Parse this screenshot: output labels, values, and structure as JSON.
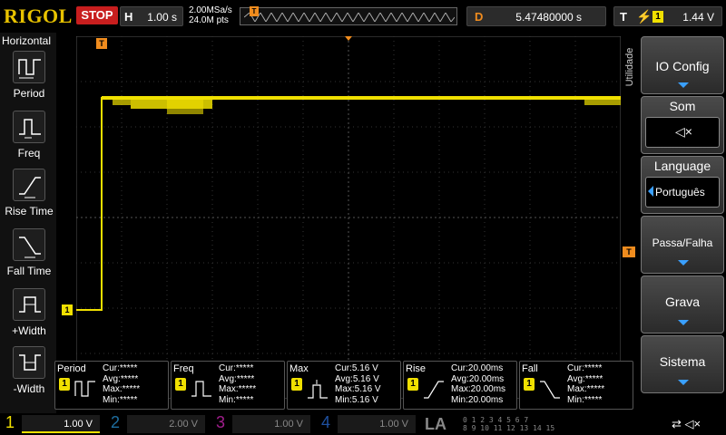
{
  "top": {
    "brand": "RIGOL",
    "run_state": "STOP",
    "timebase_label": "H",
    "timebase_value": "1.00 s",
    "sample_rate": "2.00MSa/s",
    "memory_depth": "24.0M pts",
    "trigger_marker": "T",
    "delay_label": "D",
    "delay_value": "5.47480000 s",
    "trigger_label": "T",
    "trigger_edge_icon": "rising-edge-icon",
    "trigger_source": "1",
    "trigger_level": "1.44 V"
  },
  "left_menu": {
    "title": "Horizontal",
    "items": [
      {
        "label": "Period",
        "icon": "period-icon"
      },
      {
        "label": "Freq",
        "icon": "freq-icon"
      },
      {
        "label": "Rise Time",
        "icon": "rise-time-icon"
      },
      {
        "label": "Fall Time",
        "icon": "fall-time-icon"
      },
      {
        "label": "+Width",
        "icon": "pos-width-icon"
      },
      {
        "label": "-Width",
        "icon": "neg-width-icon"
      }
    ]
  },
  "right_menu": {
    "tab": "Utilidade",
    "io_config": "IO Config",
    "sound": "Som",
    "sound_icon": "speaker-muted-icon",
    "language_label": "Language",
    "language_value": "Português",
    "pass_fail": "Passa/Falha",
    "record": "Grava",
    "system": "Sistema"
  },
  "trace": {
    "channel_marker": "1",
    "trigger_level_marker": "T",
    "color": "#f0e000"
  },
  "measurements": [
    {
      "name": "Period",
      "ch": "1",
      "icon": "period-icon",
      "lines": "Cur:*****\nAvg:*****\nMax:*****\nMin:*****"
    },
    {
      "name": "Freq",
      "ch": "1",
      "icon": "freq-icon",
      "lines": "Cur:*****\nAvg:*****\nMax:*****\nMin:*****"
    },
    {
      "name": "Max",
      "ch": "1",
      "icon": "max-icon",
      "lines": "Cur:5.16 V\nAvg:5.16 V\nMax:5.16 V\nMin:5.16 V"
    },
    {
      "name": "Rise",
      "ch": "1",
      "icon": "rise-time-icon",
      "lines": "Cur:20.00ms\nAvg:20.00ms\nMax:20.00ms\nMin:20.00ms"
    },
    {
      "name": "Fall",
      "ch": "1",
      "icon": "fall-time-icon",
      "lines": "Cur:*****\nAvg:*****\nMax:*****\nMin:*****"
    }
  ],
  "channels": [
    {
      "num": "1",
      "scale": "1.00 V",
      "color": "#f0e000"
    },
    {
      "num": "2",
      "scale": "2.00 V",
      "color": "#1e6ea0"
    },
    {
      "num": "3",
      "scale": "1.00 V",
      "color": "#a01e8c"
    },
    {
      "num": "4",
      "scale": "1.00 V",
      "color": "#1e50a0"
    }
  ],
  "la": {
    "label": "LA",
    "row1": "0 1 2 3 4 5 6 7",
    "row2": "8 9 10 11 12 13 14 15"
  },
  "status": {
    "usb_icon": "usb-icon",
    "speaker_icon": "speaker-muted-icon"
  }
}
